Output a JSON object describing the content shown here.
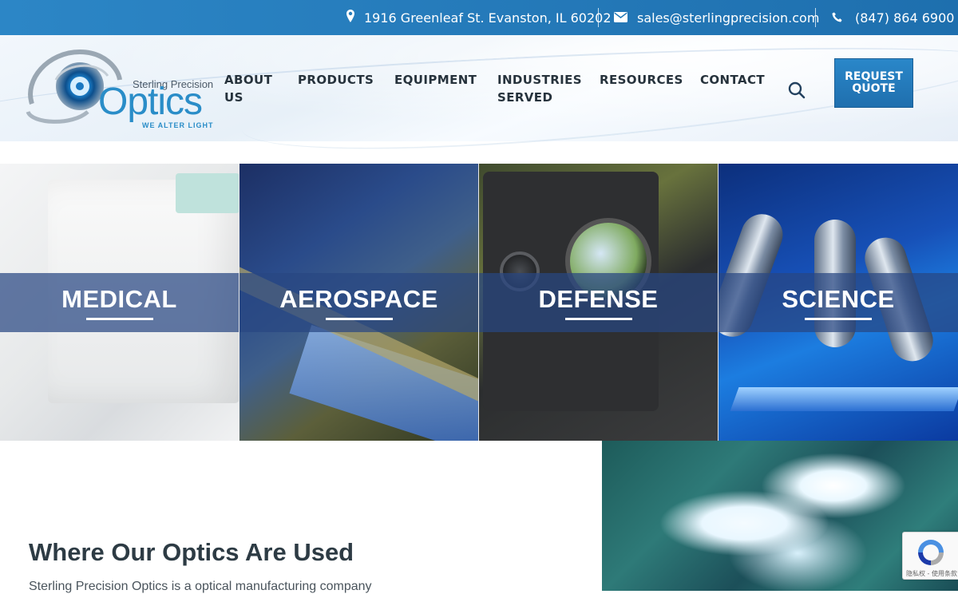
{
  "topbar": {
    "address": "1916 Greenleaf St. Evanston, IL 60202",
    "email": "sales@sterlingprecision.com",
    "phone": "(847) 864 6900",
    "icons": [
      "map-pin-icon",
      "envelope-icon",
      "phone-icon"
    ]
  },
  "logo": {
    "small": "Sterling Precision",
    "big": "Optics",
    "tagline": "WE ALTER LIGHT"
  },
  "nav": {
    "items": [
      {
        "label": "ABOUT US"
      },
      {
        "label": "PRODUCTS"
      },
      {
        "label": "EQUIPMENT"
      },
      {
        "label": "INDUSTRIES SERVED"
      },
      {
        "label": "RESOURCES"
      },
      {
        "label": "CONTACT"
      }
    ],
    "search_icon": "search-icon",
    "cta": "REQUEST QUOTE"
  },
  "tiles": [
    {
      "label": "MEDICAL"
    },
    {
      "label": "AEROSPACE"
    },
    {
      "label": "DEFENSE"
    },
    {
      "label": "SCIENCE"
    }
  ],
  "section": {
    "heading": "Where Our Optics Are Used",
    "paragraph": "Sterling Precision Optics is a optical manufacturing company"
  },
  "recaptcha": {
    "text": "隐私权 - 使用条款"
  },
  "colors": {
    "topbar": "#2079b8",
    "accent": "#2a8dc8",
    "nav_text": "#26323c",
    "band": "#284682"
  }
}
